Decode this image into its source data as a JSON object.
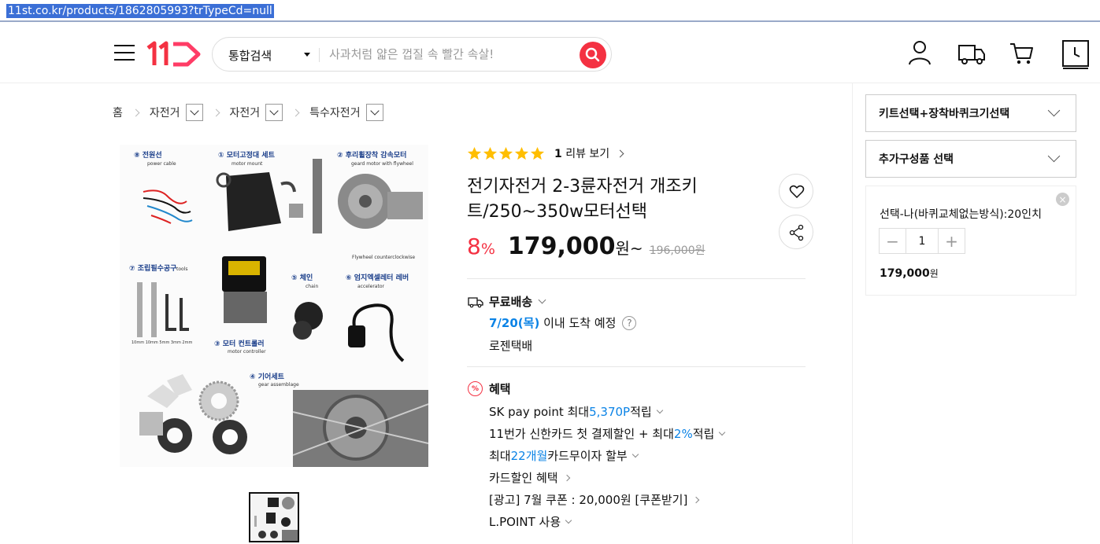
{
  "browser": {
    "url": "11st.co.kr/products/1862805993?trTypeCd=null"
  },
  "header": {
    "logo_text": "11",
    "search_category": "통합검색",
    "search_placeholder": "사과처럼 얇은 껍질 속 빨간 속살!"
  },
  "breadcrumb": [
    "홈",
    "자전거",
    "자전거",
    "특수자전거"
  ],
  "product": {
    "rating_stars": 5,
    "review_count": "1",
    "review_label": "리뷰 보기",
    "title": "전기자전거 2-3륜자전거 개조키트/250~350w모터선택",
    "discount_value": "8",
    "discount_unit": "%",
    "price": "179,000",
    "price_unit": "원~",
    "original_price": "196,000원"
  },
  "shipping": {
    "label": "무료배송",
    "date": "7/20(목)",
    "date_suffix": "이내 도착 예정",
    "carrier": "로젠택배"
  },
  "benefits": {
    "label": "혜택",
    "items": [
      {
        "pre": "SK pay point 최대 ",
        "hl": "5,370P",
        "post": " 적립"
      },
      {
        "pre": "11번가 신한카드 첫 결제할인 + 최대 ",
        "hl": "2%",
        "post": " 적립"
      },
      {
        "pre": "최대 ",
        "hl": "22개월",
        "post": " 카드무이자 할부"
      },
      {
        "pre": "카드할인 혜택",
        "hl": "",
        "post": ""
      },
      {
        "pre": "[광고] 7월 쿠폰 : 20,000원 [쿠폰받기]",
        "hl": "",
        "post": ""
      },
      {
        "pre": "L.POINT 사용",
        "hl": "",
        "post": ""
      }
    ]
  },
  "image_labels": {
    "l8": "⑧ 전원선",
    "l8en": "power cable",
    "l1": "① 모터고정대 세트",
    "l1en": "motor mount",
    "l2": "② 후리휠장착 감속모터",
    "l2en": "geard motor with flywheel",
    "l2b": "Flywheel counterclockwise",
    "l7": "⑦ 조립필수공구",
    "l7en": "tools",
    "l7a": "10mm 10mm 5mm 3mm 2mm",
    "l5": "⑤ 체인",
    "l5en": "chain",
    "l6": "⑥ 엄지엑셀레터 레버",
    "l6en": "accelerator",
    "l3": "③ 모터 컨트롤러",
    "l3en": "motor controller",
    "l4": "④ 기어세트",
    "l4en": "gear assemblage"
  },
  "options": {
    "opt1": "키트선택+장착바퀴크기선택",
    "opt2": "추가구성품 선택",
    "selected_name": "선택-나(바퀴교체없는방식):20인치",
    "quantity": "1",
    "selected_price": "179,000",
    "selected_price_unit": "원"
  },
  "colors": {
    "accent": "#f43142",
    "link": "#0b83e6",
    "star": "#ffbe00"
  }
}
